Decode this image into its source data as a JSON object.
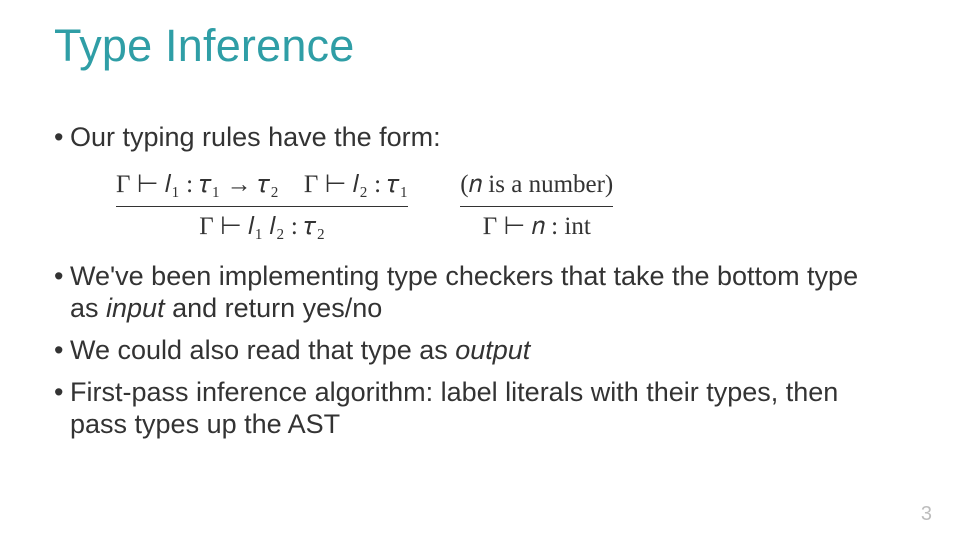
{
  "title": "Type Inference",
  "bullets": {
    "b1": "Our typing rules have the form:",
    "b2_pre": "We've been implementing type checkers that take the bottom type as ",
    "b2_em": "input",
    "b2_post": " and return yes/no",
    "b3_pre": "We could also read that type as ",
    "b3_em": "output",
    "b4": "First-pass inference algorithm: label literals with their types, then pass types up the AST"
  },
  "rules": {
    "app": {
      "premise_l": "Γ ⊢ 𝑙₁ : 𝜏₁ → 𝜏₂",
      "premise_r": "Γ ⊢ 𝑙₂ : 𝜏₁",
      "conclusion": "Γ ⊢ 𝑙₁ 𝑙₂ : 𝜏₂"
    },
    "int": {
      "premise": "(𝑛 is a number)",
      "conclusion": "Γ ⊢ 𝑛 : int"
    }
  },
  "page_number": "3",
  "bullet_dot": "•"
}
